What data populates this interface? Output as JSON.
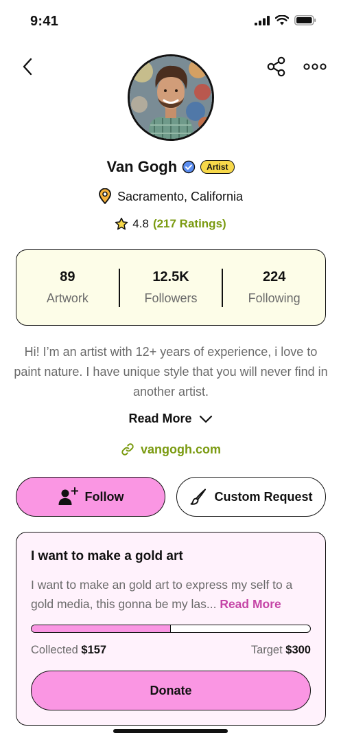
{
  "status_bar": {
    "time": "9:41"
  },
  "profile": {
    "name": "Van Gogh",
    "badge": "Artist",
    "location": "Sacramento, California",
    "rating": "4.8",
    "rating_count": "(217 Ratings)"
  },
  "stats": [
    {
      "value": "89",
      "label": "Artwork"
    },
    {
      "value": "12.5K",
      "label": "Followers"
    },
    {
      "value": "224",
      "label": "Following"
    }
  ],
  "bio": "Hi! I’m an artist with 12+ years of experience, i love to paint nature. I have unique style that you will never find in another artist.",
  "read_more_label": "Read More",
  "website": "vangogh.com",
  "actions": {
    "follow_label": "Follow",
    "custom_request_label": "Custom Request"
  },
  "campaign": {
    "title": "I want to make a gold art",
    "description": "I want to make an gold art to express my self to a gold media, this gonna be my las...",
    "read_more_label": "Read More",
    "collected_label": "Collected",
    "collected_amount": "$157",
    "target_label": "Target",
    "target_amount": "$300",
    "progress": 0.5,
    "donate_label": "Donate"
  },
  "colors": {
    "accent_pink": "#fa96e3",
    "accent_green": "#7a9a10",
    "badge_yellow": "#f7d84a",
    "stats_bg": "#fdfde8",
    "campaign_bg": "#fff2fc"
  }
}
